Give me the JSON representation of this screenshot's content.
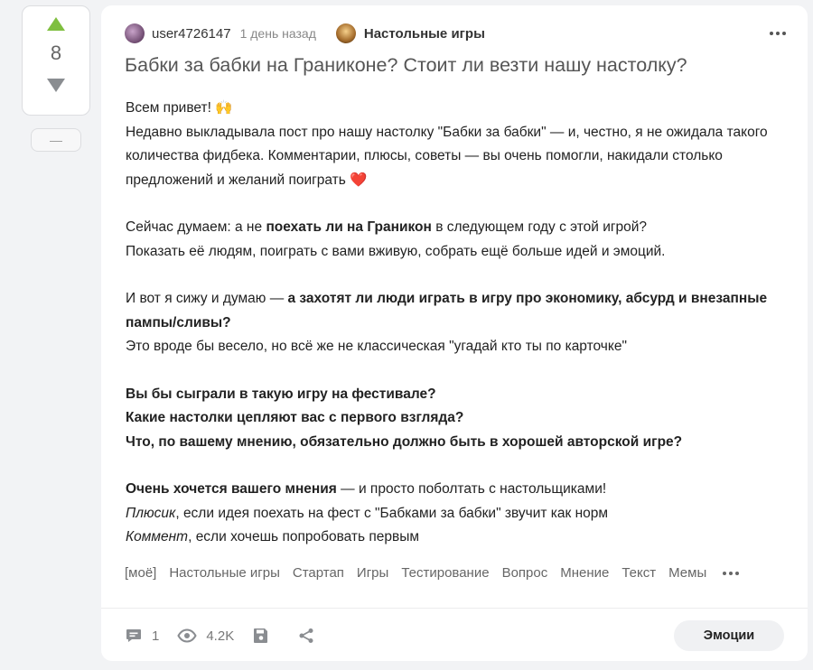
{
  "vote": {
    "count": "8",
    "collapse_label": "—"
  },
  "post": {
    "author": "user4726147",
    "time": "1 день назад",
    "community": "Настольные игры",
    "title": "Бабки за бабки на Граниконе? Стоит ли везти нашу настолку?",
    "greeting": "Всем привет! 🙌",
    "p1": "Недавно выкладывала пост про нашу настолку \"Бабки за бабки\" — и, честно, я не ожидала такого количества фидбека. Комментарии, плюсы, советы — вы очень помогли, накидали столько предложений и желаний поиграть ",
    "p1_emoji": "❤️",
    "p2_a": "Сейчас думаем: а не ",
    "p2_b": "поехать ли на Граникон",
    "p2_c": " в следующем году с этой игрой?",
    "p2_d": "Показать её людям, поиграть с вами вживую, собрать ещё больше идей и эмоций.",
    "p3_a": "И вот я сижу и думаю — ",
    "p3_b": "а захотят ли люди играть в игру про экономику, абсурд и внезапные пампы/сливы?",
    "p3_c": "Это вроде бы весело, но всё же не классическая \"угадай кто ты по карточке\"",
    "q1": "Вы бы сыграли в такую игру на фестивале?",
    "q2": "Какие настолки цепляют вас с первого взгляда?",
    "q3": "Что, по вашему мнению, обязательно должно быть в хорошей авторской игре?",
    "p5_a": "Очень хочется вашего мнения",
    "p5_b": " — и просто поболтать с настольщиками!",
    "p5_c": "Плюсик",
    "p5_d": ", если идея поехать на фест с \"Бабками за бабки\" звучит как норм",
    "p5_e": "Коммент",
    "p5_f": ", если хочешь попробовать первым"
  },
  "tags": [
    "[моё]",
    "Настольные игры",
    "Стартап",
    "Игры",
    "Тестирование",
    "Вопрос",
    "Мнение",
    "Текст",
    "Мемы"
  ],
  "footer": {
    "comments": "1",
    "views": "4.2K",
    "emotions_label": "Эмоции"
  },
  "colors": {
    "upvote": "#7fbf3f",
    "downvote": "#8a8d91",
    "background": "#f2f3f5"
  }
}
